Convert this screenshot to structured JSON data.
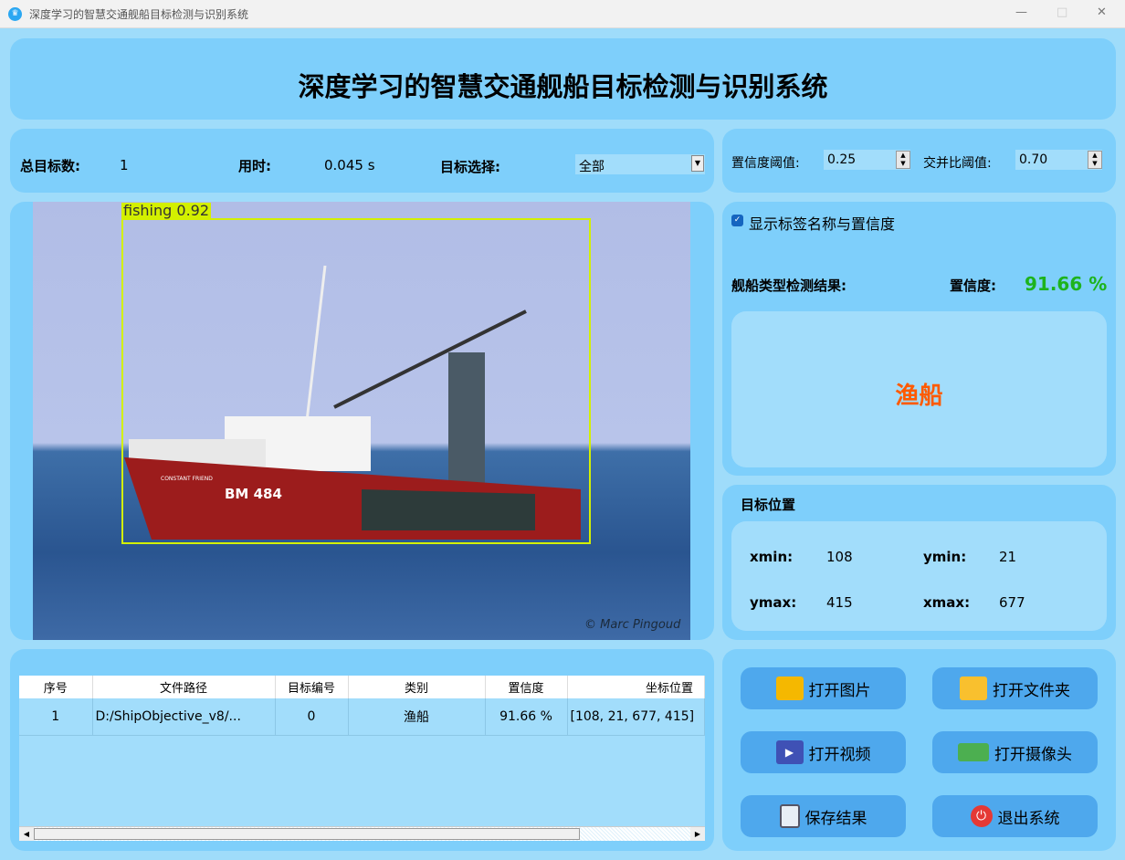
{
  "window": {
    "title": "深度学习的智慧交通舰船目标检测与识别系统",
    "min": "—",
    "max": "□",
    "close": "✕"
  },
  "header": {
    "title": "深度学习的智慧交通舰船目标检测与识别系统"
  },
  "stats": {
    "total_label": "总目标数:",
    "total_value": "1",
    "time_label": "用时:",
    "time_value": "0.045 s",
    "select_label": "目标选择:",
    "select_value": "全部"
  },
  "params": {
    "conf_label": "置信度阈值:",
    "conf_value": "0.25",
    "iou_label": "交并比阈值:",
    "iou_value": "0.70"
  },
  "image": {
    "detection_label": "fishing  0.92",
    "watermark": "© Marc Pingoud",
    "hull_text": "BM 484",
    "hull_name": "CONSTANT FRIEND"
  },
  "result": {
    "show_label": "显示标签名称与置信度",
    "type_label": "舰船类型检测结果:",
    "conf_label": "置信度:",
    "conf_value": "91.66 %",
    "class_name": "渔船",
    "accent": "#ff5a00",
    "conf_color": "#1db31d"
  },
  "position": {
    "title": "目标位置",
    "xmin_label": "xmin:",
    "xmin": "108",
    "ymin_label": "ymin:",
    "ymin": "21",
    "ymax_label": "ymax:",
    "ymax": "415",
    "xmax_label": "xmax:",
    "xmax": "677"
  },
  "table": {
    "headers": [
      "序号",
      "文件路径",
      "目标编号",
      "类别",
      "置信度",
      "坐标位置"
    ],
    "rows": [
      [
        "1",
        "D:/ShipObjective_v8/...",
        "0",
        "渔船",
        "91.66 %",
        "[108, 21, 677, 415]"
      ]
    ]
  },
  "buttons": {
    "open_image": "打开图片",
    "open_folder": "打开文件夹",
    "open_video": "打开视频",
    "open_camera": "打开摄像头",
    "save": "保存结果",
    "exit": "退出系统"
  }
}
